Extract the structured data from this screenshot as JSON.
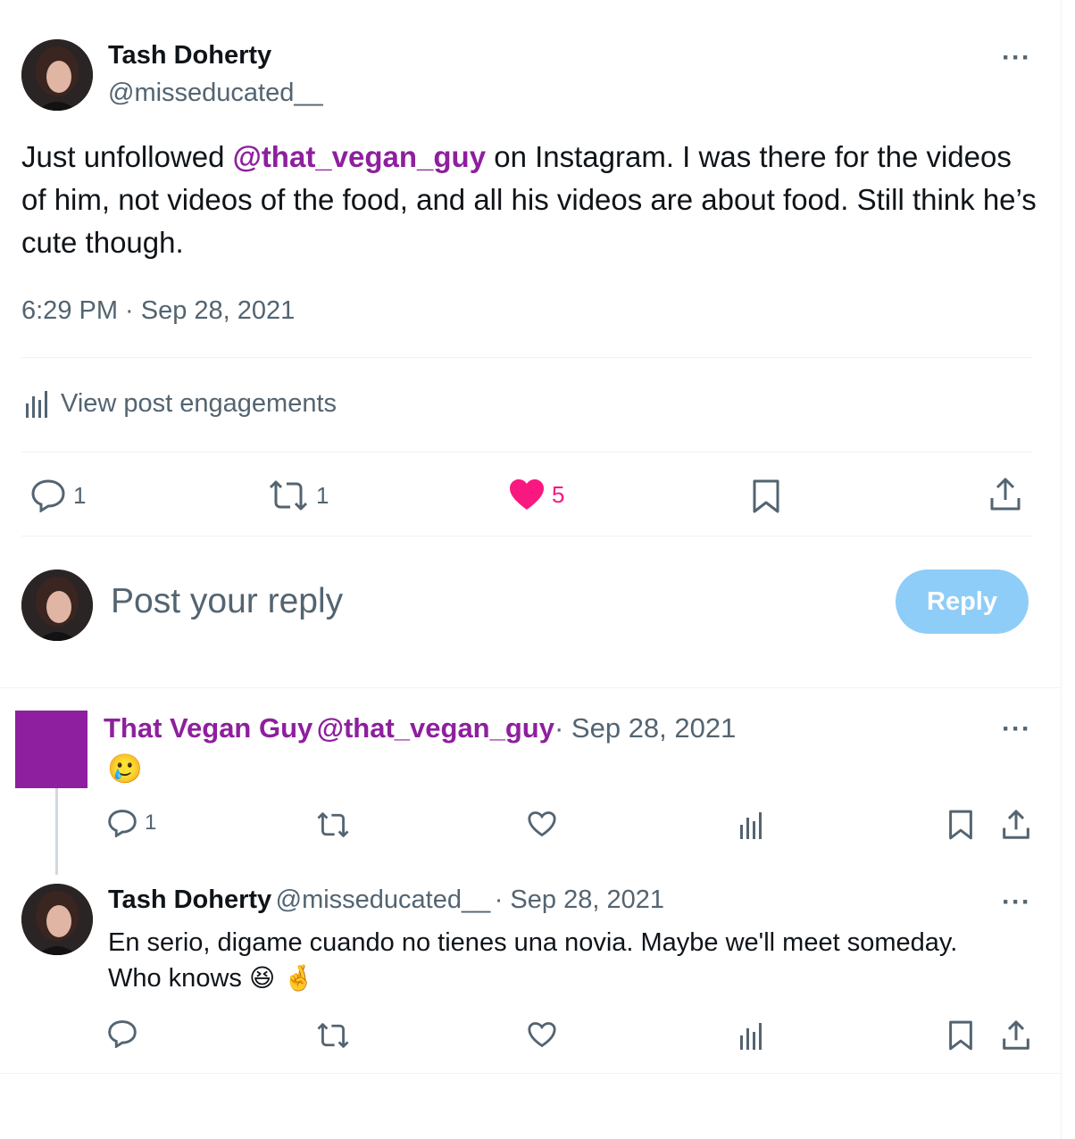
{
  "main_post": {
    "author_name": "Tash Doherty",
    "author_handle": "@misseducated__",
    "text_before": "Just unfollowed ",
    "mention": "@that_vegan_guy",
    "text_after": " on Instagram. I was there for the videos of him, not videos of the food, and all his videos are about food. Still think he’s cute though.",
    "timestamp": "6:29 PM · Sep 28, 2021",
    "engagements_label": "View post engagements",
    "actions": {
      "replies": "1",
      "reposts": "1",
      "likes": "5"
    },
    "like_color": "#f91880"
  },
  "composer": {
    "placeholder": "Post your reply",
    "button_label": "Reply",
    "button_color": "#8ecdf8"
  },
  "replies": [
    {
      "author_name": "That Vegan Guy",
      "author_handle": "@that_vegan_guy",
      "date": "· Sep 28, 2021",
      "text": "🥲",
      "replies": "1",
      "avatar_color": "#8e1f9e"
    },
    {
      "author_name": "Tash Doherty",
      "author_handle": "@misseducated__",
      "date": "· Sep 28, 2021",
      "text_line1": "En serio, digame cuando no tienes una novia. Maybe we'll meet someday.",
      "text_line2": "Who knows",
      "emojis": "😆 🤞"
    }
  ],
  "icons": [
    "more-icon",
    "analytics-icon",
    "reply-icon",
    "repost-icon",
    "heart-icon",
    "bookmark-icon",
    "share-icon"
  ]
}
